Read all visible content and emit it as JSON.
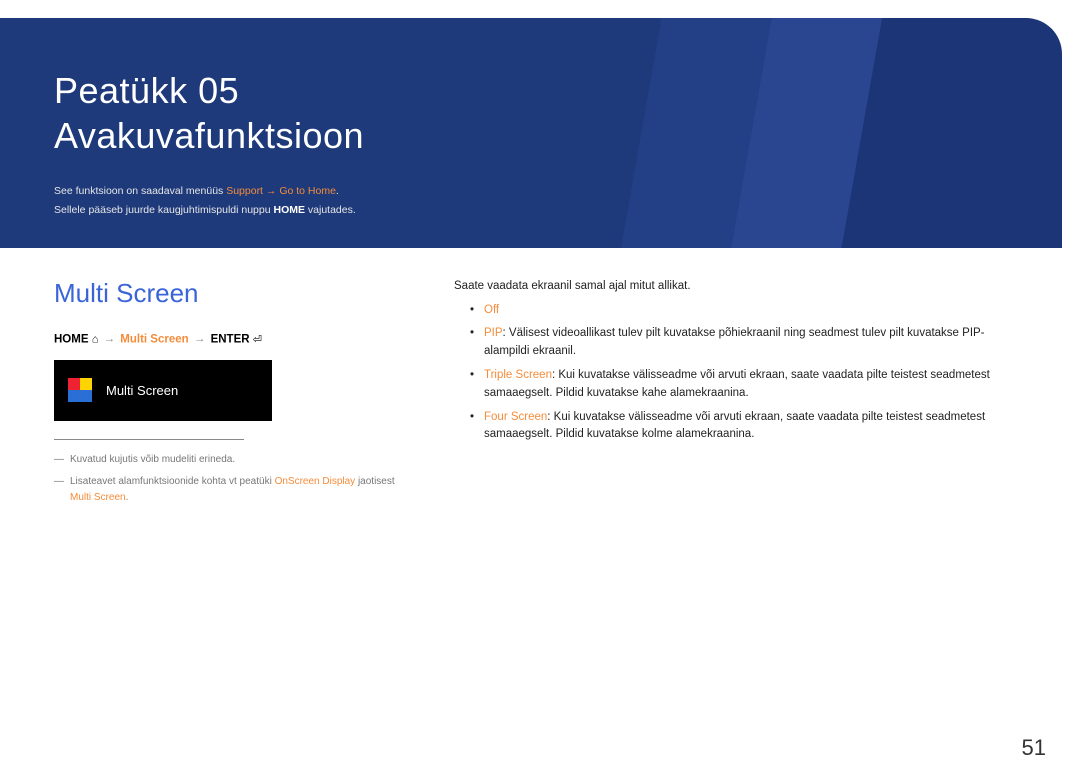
{
  "banner": {
    "chapter": "Peatükk  05",
    "title": "Avakuvafunktsioon",
    "line1_a": "See funktsioon on saadaval menüüs ",
    "line1_hl": "Support → Go to Home",
    "line1_b": ".",
    "line2_a": "Sellele pääseb juurde kaugjuhtimispuldi nuppu ",
    "line2_b": "HOME",
    "line2_c": " vajutades."
  },
  "left": {
    "section_title": "Multi Screen",
    "path": {
      "home": "HOME",
      "home_icon": "⌂",
      "arrow": "→",
      "mid": "Multi Screen",
      "enter": "ENTER",
      "enter_icon": "⏎"
    },
    "preview_label": "Multi Screen",
    "note1": "Kuvatud kujutis võib mudeliti erineda.",
    "note2_a": "Lisateavet alamfunktsioonide kohta vt peatüki ",
    "note2_hl1": "OnScreen Display",
    "note2_b": " jaotisest ",
    "note2_hl2": "Multi Screen",
    "note2_c": "."
  },
  "right": {
    "intro": "Saate vaadata ekraanil samal ajal mitut allikat.",
    "items": {
      "off": "Off",
      "pip_label": "PIP",
      "pip_text": ": Välisest videoallikast tulev pilt kuvatakse põhiekraanil ning seadmest tulev pilt kuvatakse PIP-alampildi ekraanil.",
      "triple_label": "Triple Screen",
      "triple_text": ": Kui kuvatakse välisseadme või arvuti ekraan, saate vaadata pilte teistest seadmetest samaaegselt. Pildid kuvatakse kahe alamekraanina.",
      "four_label": "Four Screen",
      "four_text": ": Kui kuvatakse välisseadme või arvuti ekraan, saate vaadata pilte teistest seadmetest samaaegselt. Pildid kuvatakse kolme alamekraanina."
    }
  },
  "page_number": "51"
}
